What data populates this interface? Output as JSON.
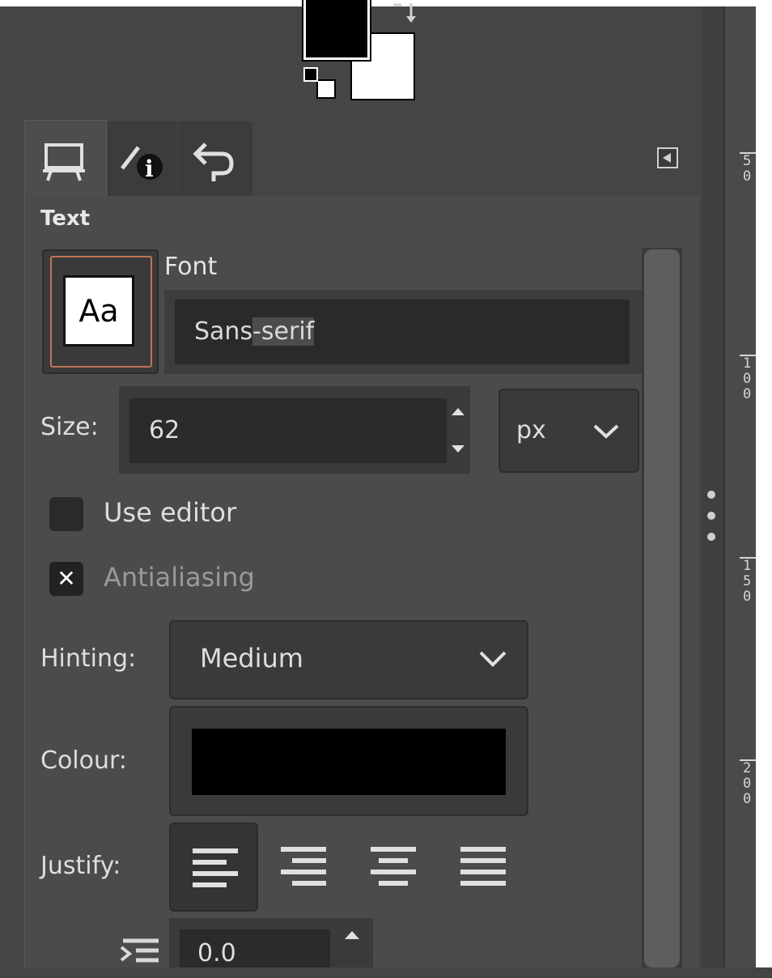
{
  "panel": {
    "title": "Text",
    "font": {
      "label": "Font",
      "preview": "Aa",
      "value_a": "Sans",
      "value_b": "-serif"
    },
    "size": {
      "label": "Size:",
      "value": "62",
      "unit": "px"
    },
    "use_editor": {
      "label": "Use editor",
      "checked": false
    },
    "antialiasing": {
      "label": "Antialiasing",
      "checked": true
    },
    "hinting": {
      "label": "Hinting:",
      "value": "Medium"
    },
    "colour": {
      "label": "Colour:",
      "value": "#000000"
    },
    "justify": {
      "label": "Justify:",
      "options": [
        "justify-left",
        "justify-right",
        "justify-center",
        "justify-fill"
      ],
      "selected": "justify-left"
    },
    "indent": {
      "value": "0.0"
    }
  },
  "tabs": [
    {
      "icon": "tool-options-icon",
      "active": true
    },
    {
      "icon": "device-status-icon",
      "active": false
    },
    {
      "icon": "undo-history-icon",
      "active": false
    }
  ],
  "ruler": {
    "labels": [
      "5\n0",
      "1\n0\n0",
      "1\n5\n0",
      "2\n0\n0"
    ]
  },
  "colors": {
    "foreground": "#000000",
    "background": "#ffffff",
    "accent_border": "#c0735a"
  }
}
